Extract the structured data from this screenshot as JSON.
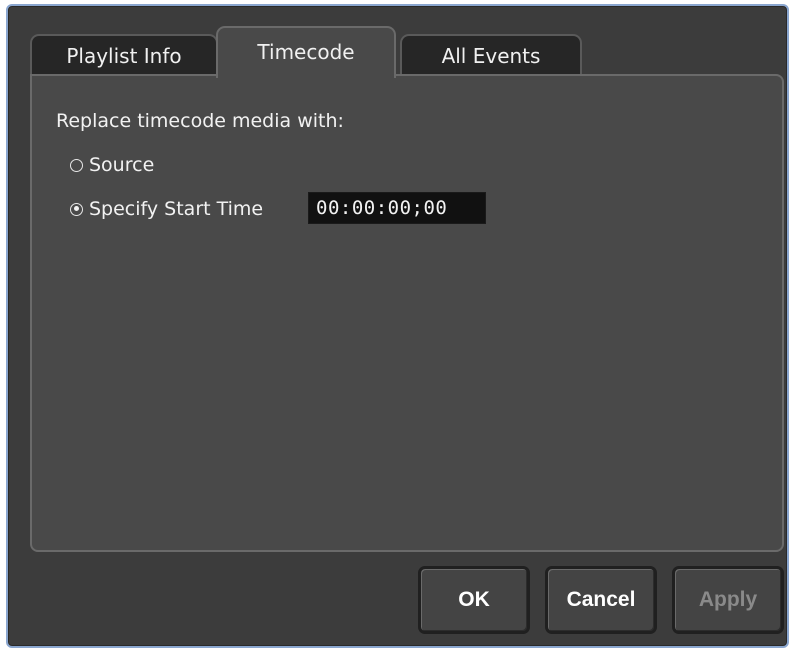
{
  "tabs": [
    {
      "label": "Playlist Info",
      "active": false
    },
    {
      "label": "Timecode",
      "active": true
    },
    {
      "label": "All Events",
      "active": false
    }
  ],
  "timecode": {
    "heading": "Replace timecode media with:",
    "options": [
      {
        "label": "Source",
        "selected": false
      },
      {
        "label": "Specify Start Time",
        "selected": true
      }
    ],
    "start_time": "00:00:00;00"
  },
  "buttons": {
    "ok": "OK",
    "cancel": "Cancel",
    "apply": "Apply",
    "apply_enabled": false
  },
  "colors": {
    "frame_border": "#8aa6cf",
    "background": "#3c3c3c",
    "panel": "#494949",
    "field_bg": "#111111"
  }
}
